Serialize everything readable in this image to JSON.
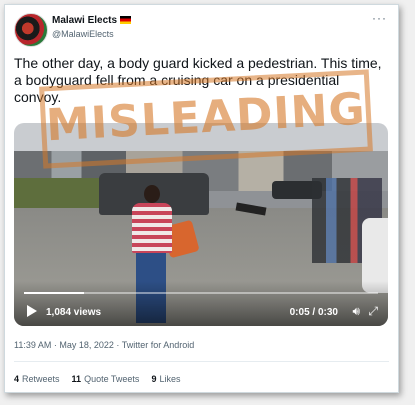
{
  "author": {
    "display_name": "Malawi Elects",
    "handle": "@MalawiElects"
  },
  "more_icon": "···",
  "tweet": {
    "text": "The other day, a body guard kicked a pedestrian. This time, a bodyguard fell from a cruising car on a presidential convoy."
  },
  "overlay": {
    "stamp_text": "MISLEADING",
    "stamp_color": "#d67828"
  },
  "video": {
    "views": "1,084 views",
    "time": "0:05 / 0:30",
    "progress_fraction": 0.17,
    "icons": {
      "play": "play-icon",
      "volume": "volume-icon",
      "expand": "expand-icon"
    }
  },
  "meta": {
    "timestamp": "11:39 AM · May 18, 2022 · Twitter for Android"
  },
  "stats": {
    "retweets_count": "4",
    "retweets_label": "Retweets",
    "quotes_count": "11",
    "quotes_label": "Quote Tweets",
    "likes_count": "9",
    "likes_label": "Likes"
  },
  "colors": {
    "text_primary": "#0f1419",
    "text_secondary": "#536471"
  }
}
